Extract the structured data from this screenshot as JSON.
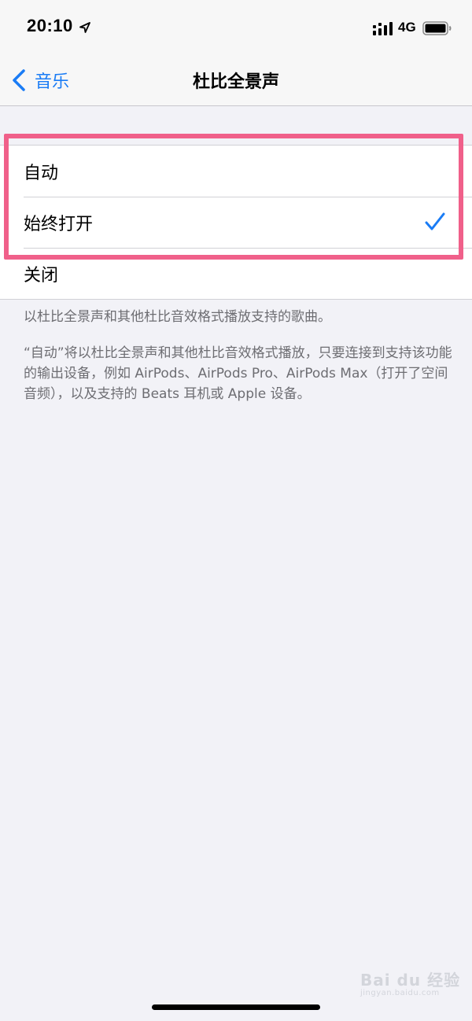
{
  "status_bar": {
    "time": "20:10",
    "network": "4G",
    "icons": [
      "location-arrow-icon",
      "cellular-signal-icon",
      "battery-icon"
    ]
  },
  "nav": {
    "back_label": "音乐",
    "title": "杜比全景声"
  },
  "options": [
    {
      "label": "自动",
      "selected": false
    },
    {
      "label": "始终打开",
      "selected": true
    },
    {
      "label": "关闭",
      "selected": false
    }
  ],
  "footer": {
    "line1": "以杜比全景声和其他杜比音效格式播放支持的歌曲。",
    "line2": "“自动”将以杜比全景声和其他杜比音效格式播放，只要连接到支持该功能的输出设备，例如 AirPods、AirPods Pro、AirPods Max（打开了空间音频），以及支持的 Beats 耳机或 Apple 设备。"
  },
  "watermark": {
    "text": "Bai du 经验",
    "sub": "jingyan.baidu.com"
  },
  "colors": {
    "accent": "#1a7cf5",
    "highlight": "#f0608a",
    "background": "#f2f2f7",
    "footer_text": "#6d6d72"
  }
}
